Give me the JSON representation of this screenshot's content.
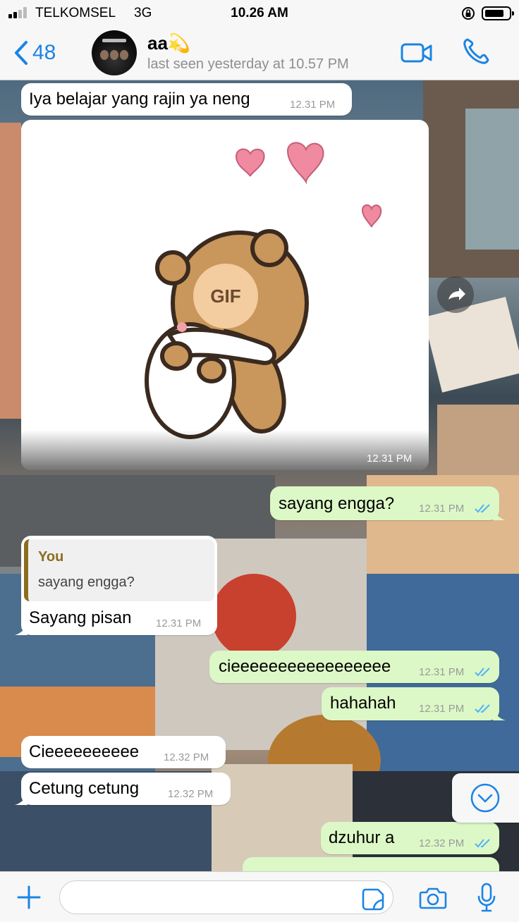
{
  "status_bar": {
    "carrier": "TELKOMSEL",
    "network": "3G",
    "time": "10.26 AM"
  },
  "header": {
    "back_count": "48",
    "contact_name": "aa💫",
    "last_seen": "last seen yesterday at 10.57 PM"
  },
  "messages": [
    {
      "dir": "in",
      "text": "Iya belajar yang rajin ya neng",
      "time": "12.31 PM"
    },
    {
      "dir": "in",
      "type": "gif",
      "badge": "GIF",
      "time": "12.31 PM"
    },
    {
      "dir": "out",
      "text": "sayang engga?",
      "time": "12.31 PM"
    },
    {
      "dir": "in",
      "quote_author": "You",
      "quote_text": "sayang engga?",
      "text": "Sayang pisan",
      "time": "12.31 PM"
    },
    {
      "dir": "out",
      "text": "cieeeeeeeeeeeeeeeee",
      "time": "12.31 PM"
    },
    {
      "dir": "out",
      "text": "hahahah",
      "time": "12.31 PM"
    },
    {
      "dir": "in",
      "text": "Cieeeeeeeeee",
      "time": "12.32 PM"
    },
    {
      "dir": "in",
      "text": "Cetung cetung",
      "time": "12.32 PM"
    },
    {
      "dir": "out",
      "text": "dzuhur a",
      "time": "12.32 PM"
    }
  ],
  "composer": {
    "value": "",
    "placeholder": ""
  },
  "colors": {
    "accent": "#1a84e5",
    "outgoing_bubble": "#dcf8c6",
    "incoming_bubble": "#ffffff",
    "quote_bar": "#8c6d1f"
  }
}
